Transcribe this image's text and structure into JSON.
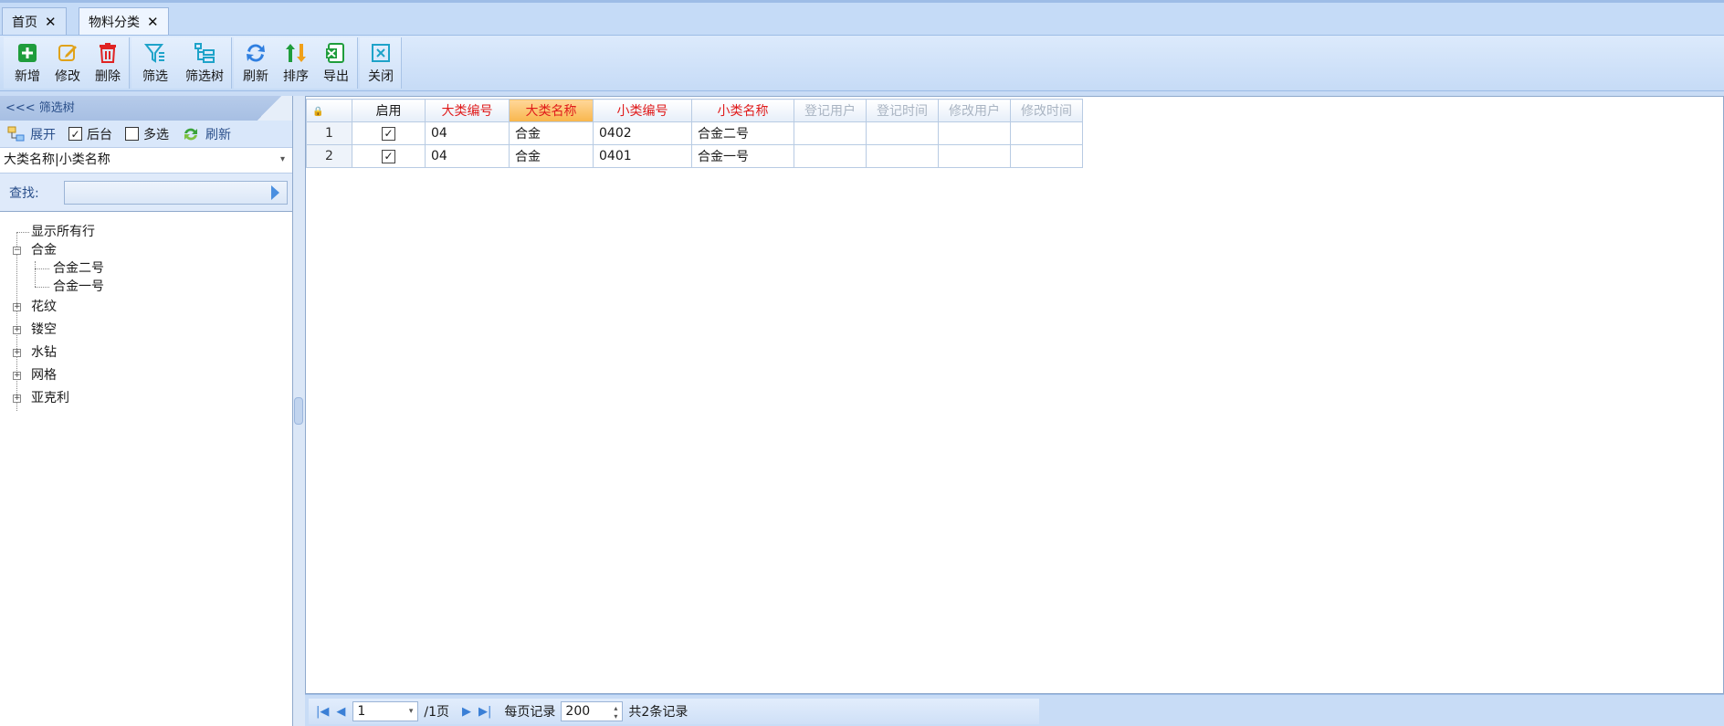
{
  "tabs": [
    {
      "label": "首页",
      "close": "✕"
    },
    {
      "label": "物料分类",
      "close": "✕"
    }
  ],
  "toolbar": {
    "add": "新增",
    "edit": "修改",
    "delete": "删除",
    "filter": "筛选",
    "filter_tree": "筛选树",
    "refresh": "刷新",
    "sort": "排序",
    "export": "导出",
    "close": "关闭"
  },
  "left_panel": {
    "header": "<<< 筛选树",
    "expand": "展开",
    "background": "后台",
    "background_checked": "✓",
    "multiselect": "多选",
    "refresh": "刷新",
    "combo_value": "大类名称|小类名称",
    "search_label": "查找:",
    "tree": {
      "show_all": "显示所有行",
      "alloy": "合金",
      "alloy_2": "合金二号",
      "alloy_1": "合金一号",
      "pattern": "花纹",
      "hollow": "镂空",
      "rhinestone": "水钻",
      "mesh": "网格",
      "acrylic": "亚克利",
      "minus": "−",
      "plus": "+"
    }
  },
  "grid": {
    "columns": [
      "启用",
      "大类编号",
      "大类名称",
      "小类编号",
      "小类名称",
      "登记用户",
      "登记时间",
      "修改用户",
      "修改时间"
    ],
    "rows": [
      {
        "rn": "1",
        "enabled": "✓",
        "cat_code": "04",
        "cat_name": "合金",
        "sub_code": "0402",
        "sub_name": "合金二号"
      },
      {
        "rn": "2",
        "enabled": "✓",
        "cat_code": "04",
        "cat_name": "合金",
        "sub_code": "0401",
        "sub_name": "合金一号"
      }
    ]
  },
  "pager": {
    "page": "1",
    "total_pages": "/1页",
    "per_page_label": "每页记录",
    "per_page": "200",
    "total": "共2条记录"
  },
  "colors": {
    "accent": "#3a7fd6",
    "header_red": "#e01b1b",
    "selected_header": "#f8b64c"
  }
}
